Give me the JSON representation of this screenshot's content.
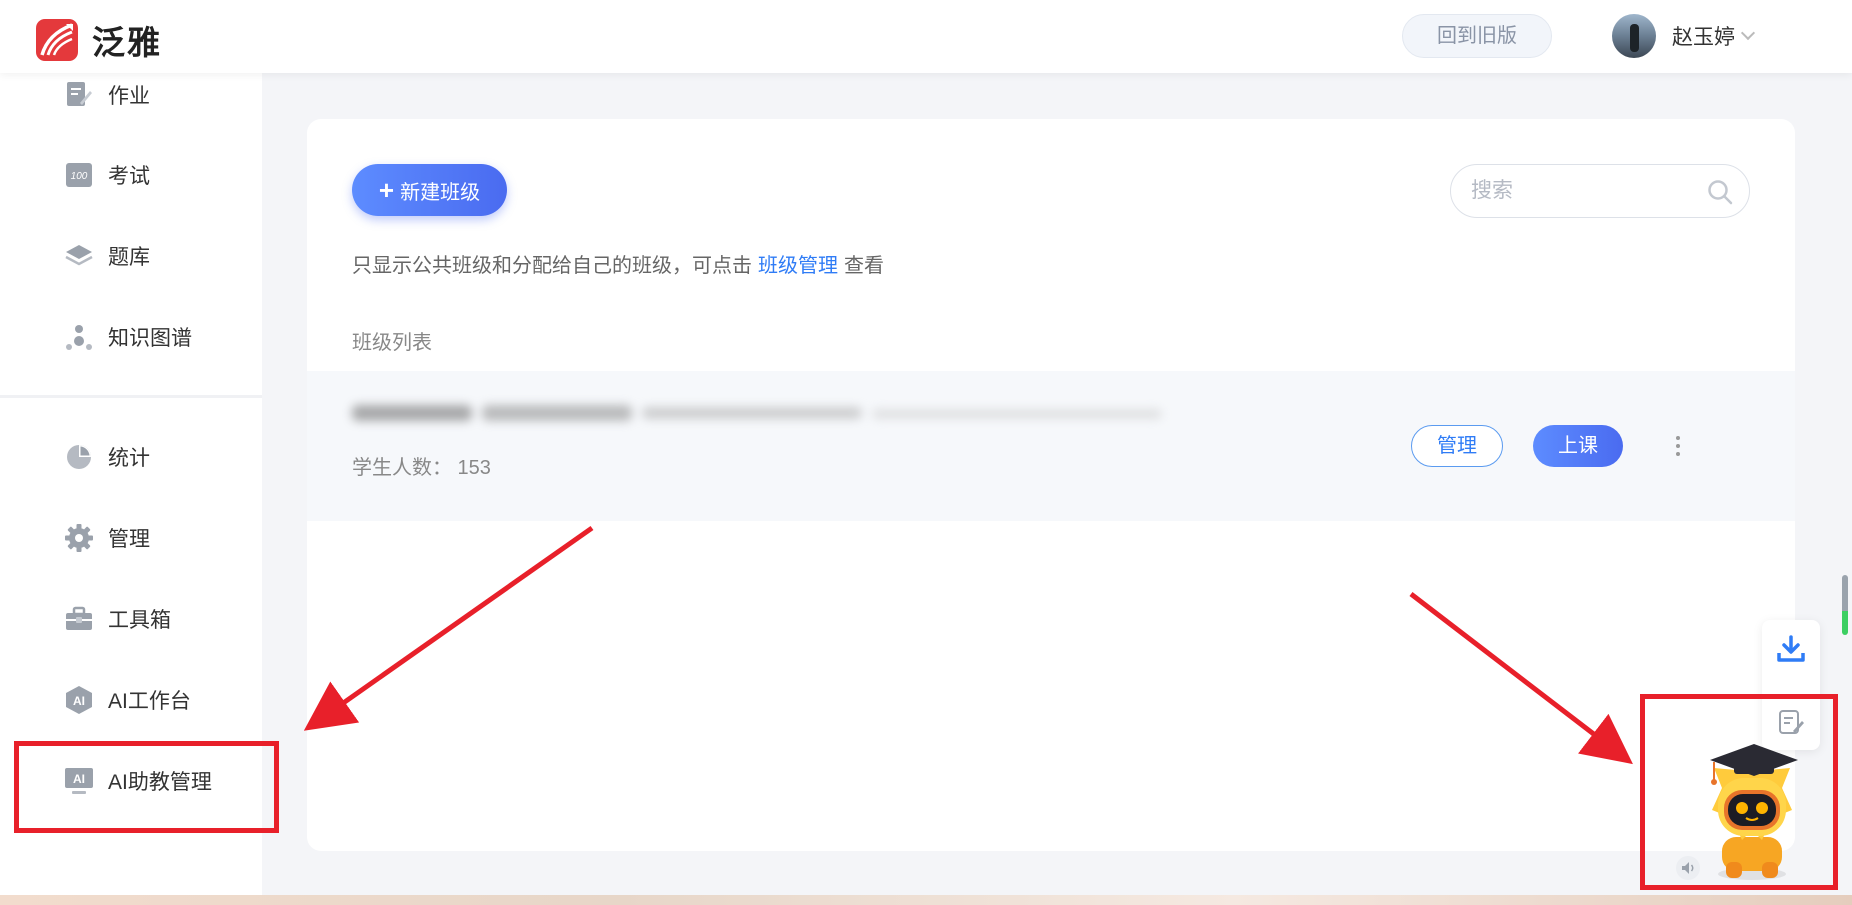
{
  "header": {
    "brand": "泛雅",
    "old_version_label": "回到旧版",
    "user_name": "赵玉婷"
  },
  "sidebar": {
    "items": [
      {
        "label": "作业",
        "icon": "homework-icon"
      },
      {
        "label": "考试",
        "icon": "exam-100-icon"
      },
      {
        "label": "题库",
        "icon": "layers-icon"
      },
      {
        "label": "知识图谱",
        "icon": "knowledge-graph-icon"
      },
      {
        "label": "统计",
        "icon": "pie-chart-icon"
      },
      {
        "label": "管理",
        "icon": "gear-icon"
      },
      {
        "label": "工具箱",
        "icon": "toolbox-icon"
      },
      {
        "label": "AI工作台",
        "icon": "ai-badge-icon"
      },
      {
        "label": "AI助教管理",
        "icon": "ai-monitor-icon"
      }
    ]
  },
  "main": {
    "new_class_label": "新建班级",
    "search_placeholder": "搜索",
    "hint": {
      "prefix": "只显示公共班级和分配给自己的班级，可点击",
      "link": "班级管理",
      "suffix": "查看"
    },
    "list_title": "班级列表",
    "classes": [
      {
        "students_label": "学生人数： 153",
        "manage_label": "管理",
        "start_class_label": "上课"
      }
    ]
  },
  "colors": {
    "accent": "#4a6bf0",
    "link": "#2f7cf6",
    "brand_red": "#e4393c",
    "annotation_red": "#e8202a"
  }
}
